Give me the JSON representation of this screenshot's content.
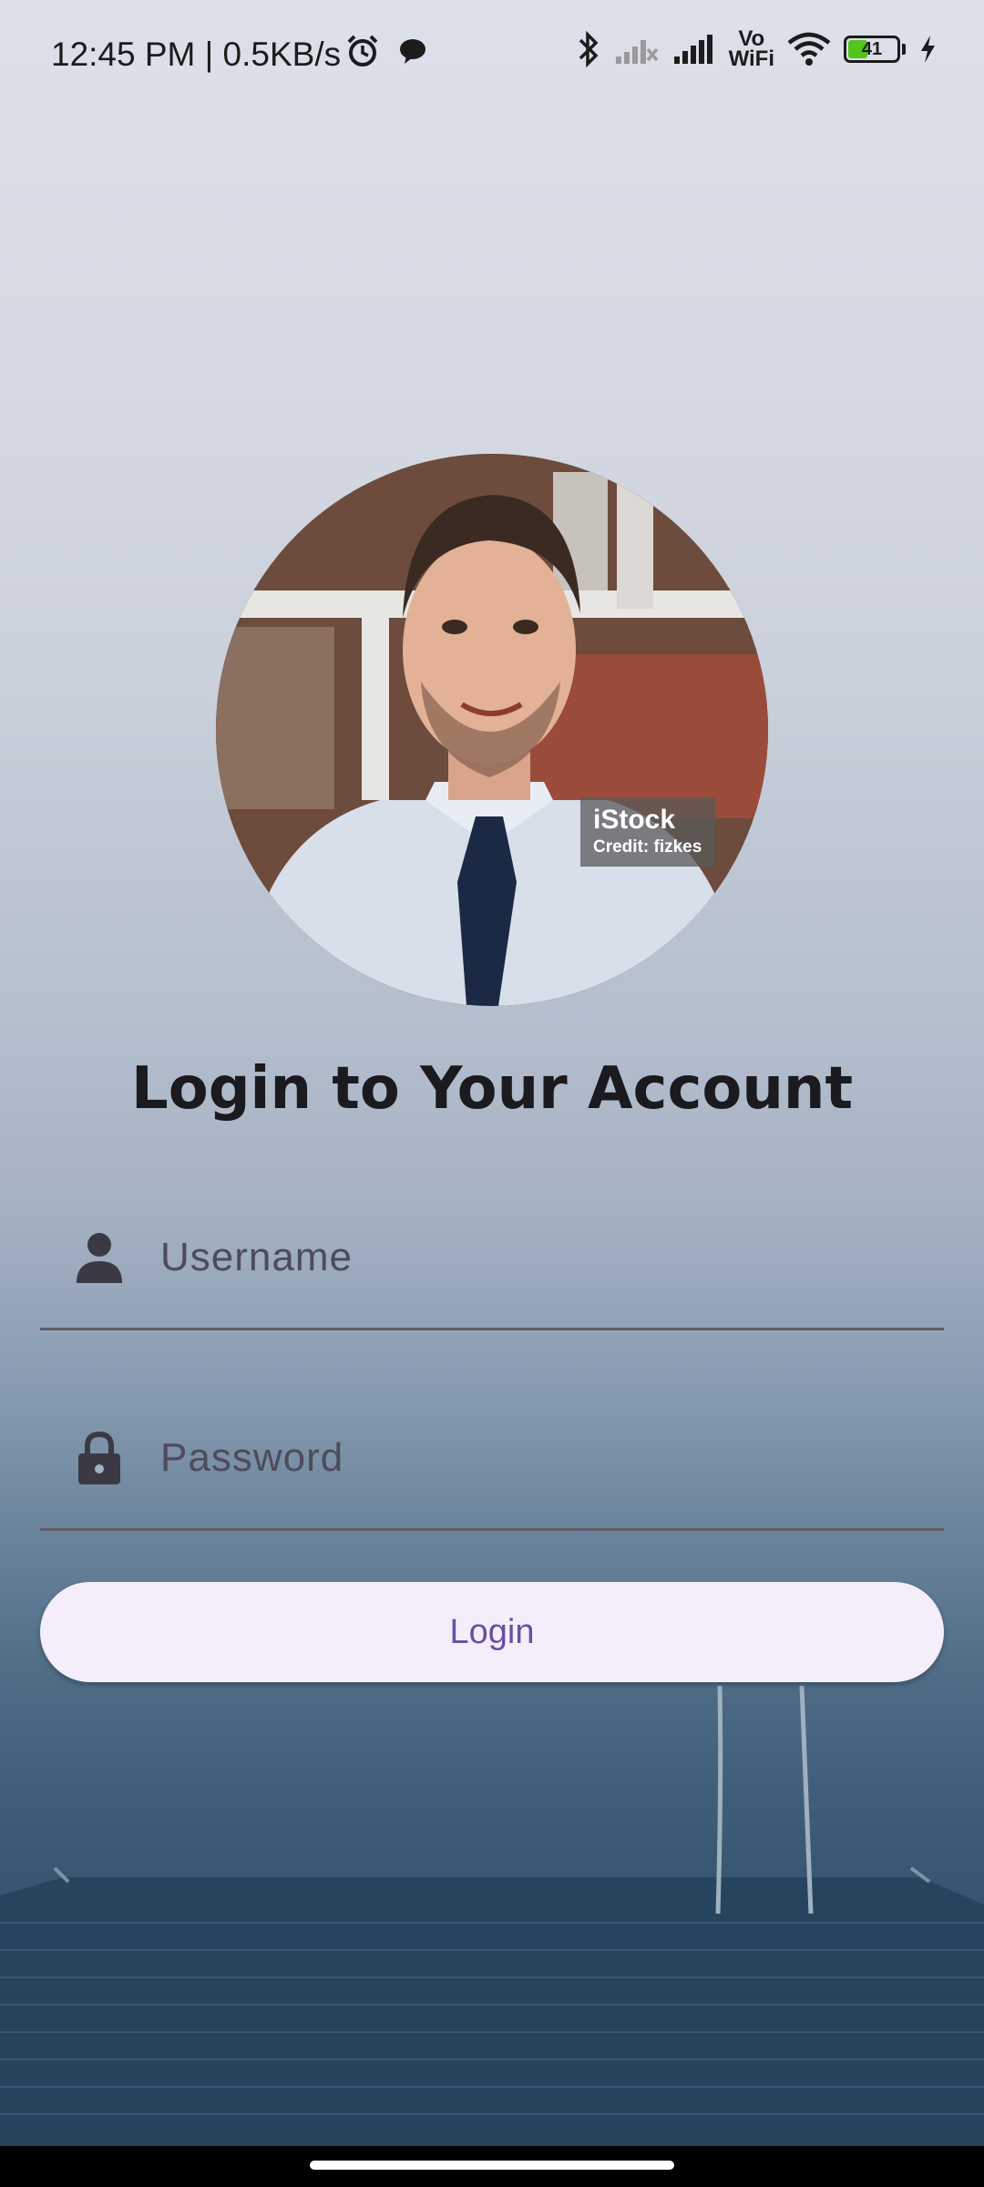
{
  "status_bar": {
    "time_speed": "12:45 PM | 0.5KB/s",
    "vowifi_top": "Vo",
    "vowifi_bottom": "WiFi",
    "battery_level": "41",
    "battery_color": "#52c41a"
  },
  "avatar": {
    "watermark_brand": "iStock",
    "watermark_credit": "Credit: fizkes"
  },
  "title": "Login to Your Account",
  "form": {
    "username_placeholder": "Username",
    "username_value": "",
    "password_placeholder": "Password",
    "password_value": ""
  },
  "login_button_label": "Login",
  "colors": {
    "button_background": "#f4eefa",
    "button_text": "#6a4fa0",
    "title": "#1a1a1f"
  }
}
